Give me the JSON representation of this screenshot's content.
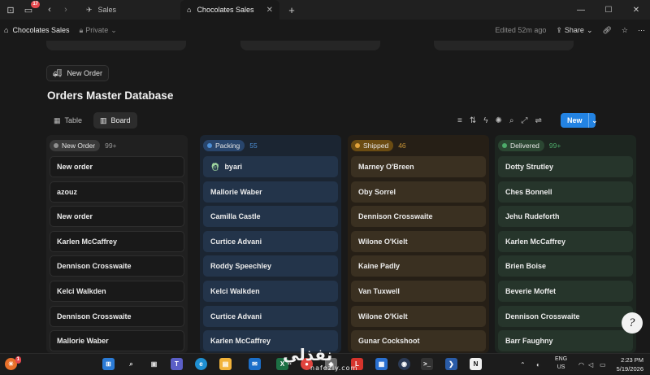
{
  "window": {
    "tab_count_badge": "17",
    "tabs": [
      {
        "label": "Sales",
        "icon": "airplane-icon"
      },
      {
        "label": "Chocolates Sales",
        "icon": "house-icon"
      }
    ],
    "new_tab": "+",
    "controls": [
      "minimize",
      "maximize",
      "close"
    ]
  },
  "topbar": {
    "page_name": "Chocolates Sales",
    "privacy": "Private",
    "edited": "Edited 52m ago",
    "share": "Share"
  },
  "page": {
    "new_order_chip": "New Order",
    "title": "Orders Master Database",
    "views": [
      "Table",
      "Board"
    ],
    "active_view": "Board",
    "new_button": "New"
  },
  "board": {
    "columns": [
      {
        "status": "New Order",
        "count": "99+",
        "pill_bg": "#3a3a3a",
        "dot": "#8f8f8f",
        "col_bg": "#202020",
        "card_bg": "#191919",
        "card_border": "#2e2e2e",
        "count_color": "#9a9a9a",
        "cards": [
          "New order",
          "azouz",
          "New order",
          "Karlen McCaffrey",
          "Dennison Crosswaite",
          "Kelci Walkden",
          "Dennison Crosswaite",
          "Mallorie Waber"
        ]
      },
      {
        "status": "Packing",
        "count": "55",
        "pill_bg": "#28456c",
        "dot": "#4d8fd6",
        "col_bg": "#1b2532",
        "card_bg": "#23344a",
        "card_border": "#23344a",
        "count_color": "#4d8fd6",
        "cards": [
          "byari",
          "Mallorie Waber",
          "Camilla Castle",
          "Curtice Advani",
          "Roddy Speechley",
          "Kelci Walkden",
          "Curtice Advani",
          "Karlen McCaffrey"
        ]
      },
      {
        "status": "Shipped",
        "count": "46",
        "pill_bg": "#6b4c12",
        "dot": "#e1a23b",
        "col_bg": "#261f16",
        "card_bg": "#3a3021",
        "card_border": "#3a3021",
        "count_color": "#c99537",
        "cards": [
          "Marney O'Breen",
          "Oby Sorrel",
          "Dennison Crosswaite",
          "Wilone O'Kielt",
          "Kaine Padly",
          "Van Tuxwell",
          "Wilone O'Kielt",
          "Gunar Cockshoot"
        ]
      },
      {
        "status": "Delivered",
        "count": "99+",
        "pill_bg": "#2b4632",
        "dot": "#4dab6a",
        "col_bg": "#1d2620",
        "card_bg": "#26352b",
        "card_border": "#26352b",
        "count_color": "#4dab6a",
        "cards": [
          "Dotty Strutley",
          "Ches Bonnell",
          "Jehu Rudeforth",
          "Karlen McCaffrey",
          "Brien Boise",
          "Beverie Moffet",
          "Dennison Crosswaite",
          "Barr Faughny"
        ]
      }
    ]
  },
  "taskbar": {
    "weather_badge": "1",
    "language": [
      "ENG",
      "US"
    ],
    "time": "2:23 PM",
    "date": "5/19/2026"
  },
  "watermark": {
    "text": "نفذلي",
    "sub": "nafezly.com"
  }
}
